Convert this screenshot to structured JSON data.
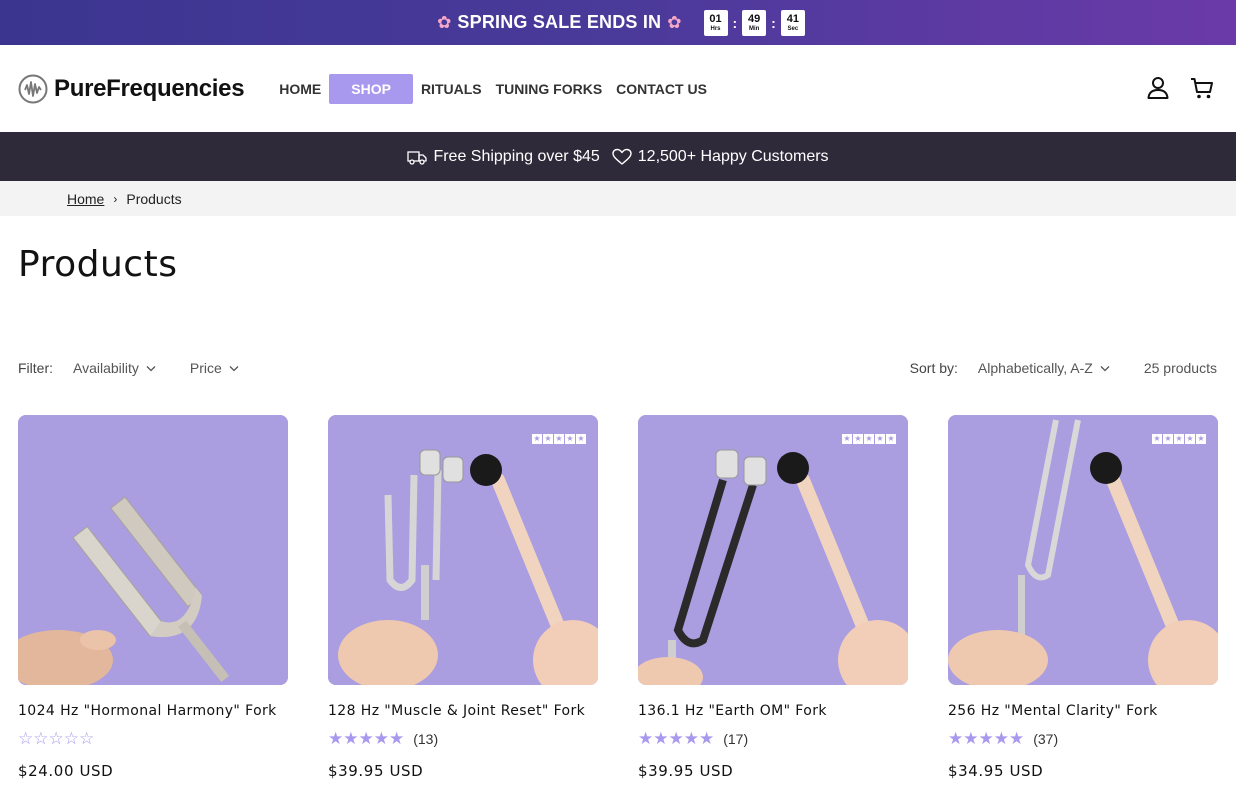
{
  "promo": {
    "text": "SPRING SALE ENDS IN",
    "flower_icon": "cherry-blossom-icon",
    "timer": [
      {
        "value": "01",
        "unit": "Hrs"
      },
      {
        "value": "49",
        "unit": "Min"
      },
      {
        "value": "41",
        "unit": "Sec"
      }
    ],
    "separator": ":"
  },
  "header": {
    "logo_text": "PureFrequencies",
    "nav": [
      {
        "label": "HOME"
      },
      {
        "label": "SHOP"
      },
      {
        "label": "RITUALS"
      },
      {
        "label": "TUNING FORKS"
      },
      {
        "label": "CONTACT US"
      }
    ],
    "account_icon": "account-icon",
    "cart_icon": "cart-icon"
  },
  "trust": {
    "shipping": "Free Shipping over $45",
    "customers": "12,500+ Happy Customers"
  },
  "breadcrumb": {
    "home": "Home",
    "separator": "›",
    "current": "Products"
  },
  "page": {
    "title": "Products"
  },
  "filters": {
    "filter_label": "Filter:",
    "availability": "Availability",
    "price": "Price",
    "sort_label": "Sort by:",
    "sort_value": "Alphabetically, A-Z",
    "count": "25 products"
  },
  "products": [
    {
      "title": "1024 Hz \"Hormonal Harmony\" Fork",
      "rating": 0,
      "reviews": "",
      "price": "$24.00 USD",
      "badge": false
    },
    {
      "title": "128 Hz \"Muscle & Joint Reset\" Fork",
      "rating": 5,
      "reviews": "(13)",
      "price": "$39.95 USD",
      "badge": true
    },
    {
      "title": "136.1 Hz \"Earth OM\" Fork",
      "rating": 5,
      "reviews": "(17)",
      "price": "$39.95 USD",
      "badge": true
    },
    {
      "title": "256 Hz \"Mental Clarity\" Fork",
      "rating": 5,
      "reviews": "(37)",
      "price": "$34.95 USD",
      "badge": true
    }
  ],
  "colors": {
    "accent": "#a999ee",
    "image_bg": "#aa9de0",
    "trust_bar": "#2e2a3a"
  }
}
